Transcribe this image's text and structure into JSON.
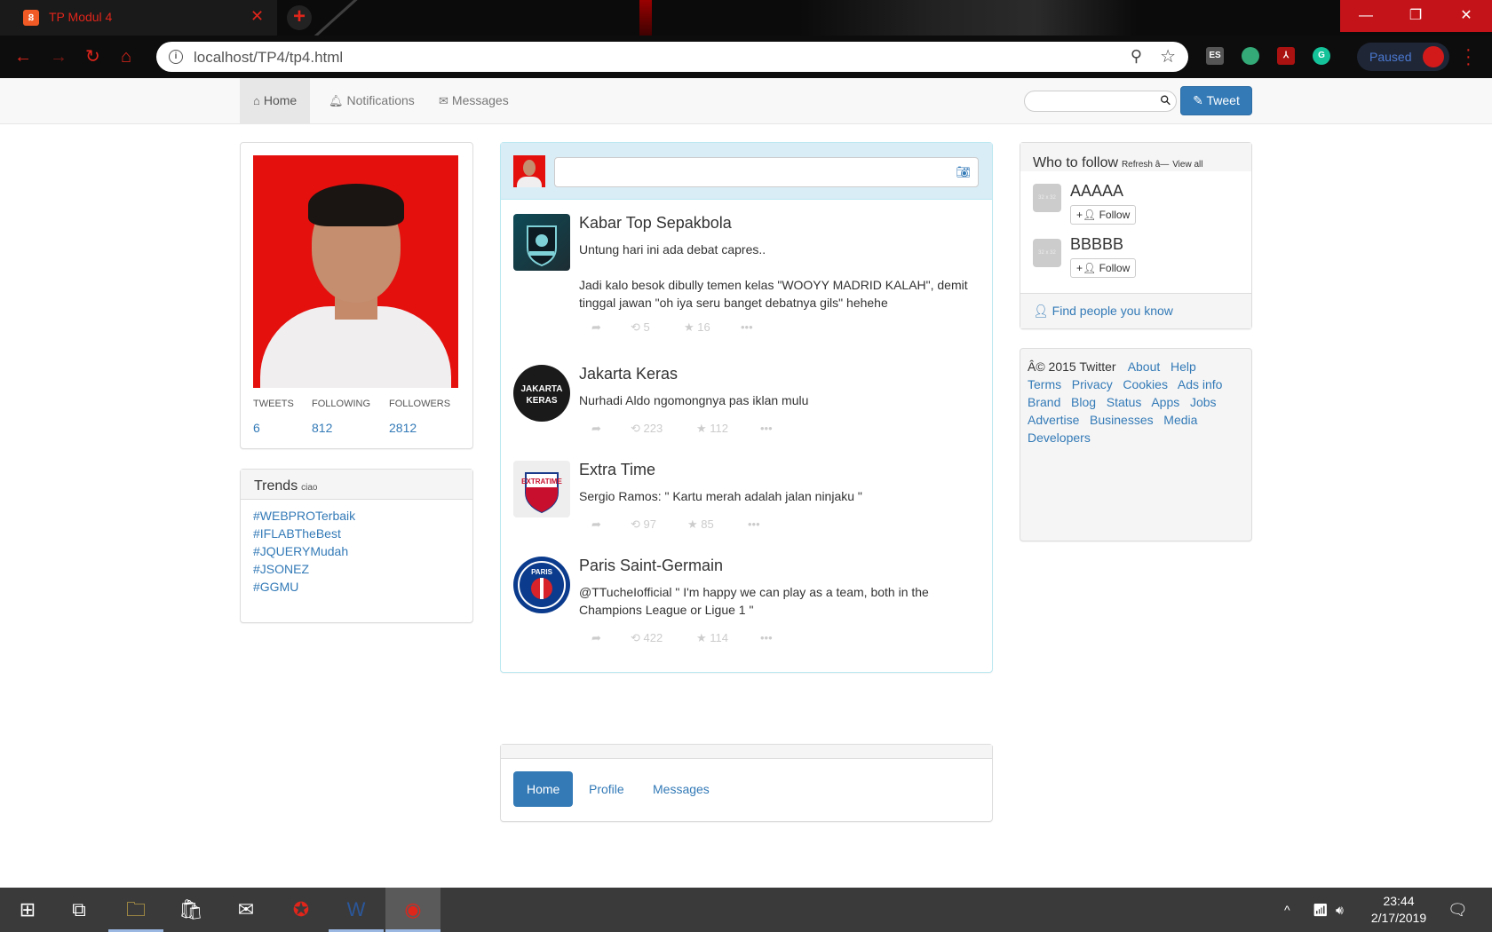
{
  "browser": {
    "tab_title": "TP Modul 4",
    "tab_close": "✕",
    "new_tab": "+",
    "url_host": "localhost",
    "url_path": "/TP4/tp4.html",
    "profile_status": "Paused",
    "ext_es": "ES",
    "window_controls": {
      "minimize": "—",
      "restore": "❐",
      "close": "✕"
    },
    "accent_color": "#e0251b"
  },
  "navbar": {
    "home": "Home",
    "notifications": "Notifications",
    "messages": "Messages",
    "search_placeholder": "",
    "tweet_button": "Tweet"
  },
  "profile": {
    "stats": [
      {
        "label": "TWEETS",
        "value": "6"
      },
      {
        "label": "FOLLOWING",
        "value": "812"
      },
      {
        "label": "FOLLOWERS",
        "value": "2812"
      }
    ]
  },
  "trends": {
    "title": "Trends",
    "subtitle": "ciao",
    "items": [
      "#WEBPROTerbaik",
      "#IFLABTheBest",
      "#JQUERYMudah",
      "#JSONEZ",
      "#GGMU"
    ]
  },
  "compose": {
    "placeholder": ""
  },
  "tweets": [
    {
      "name": "Kabar Top Sepakbola",
      "text": "Untung hari ini ada debat capres..\n\nJadi kalo besok dibully temen kelas \"WOOYY MADRID KALAH\", demit tinggal jawan \"oh iya seru banget debatnya gils\" hehehe",
      "retweets": "5",
      "likes": "16"
    },
    {
      "name": "Jakarta Keras",
      "text": "Nurhadi Aldo ngomongnya pas iklan mulu",
      "retweets": "223",
      "likes": "112",
      "avatar_text": "JAKARTA KERAS"
    },
    {
      "name": "Extra Time",
      "text": "Sergio Ramos: \" Kartu merah adalah jalan ninjaku \"",
      "retweets": "97",
      "likes": "85",
      "avatar_text": "EXTRATIME"
    },
    {
      "name": "Paris Saint-Germain",
      "text": "@TTucheIofficial \" I'm happy we can play as a team, both in the Champions League or Ligue 1 \"",
      "retweets": "422",
      "likes": "114",
      "avatar_text": "PARIS"
    }
  ],
  "who_to_follow": {
    "title": "Who to follow",
    "refresh": "Refresh â—",
    "view_all": "View all",
    "suggestions": [
      {
        "name": "AAAAA",
        "button": "Follow",
        "avatar_text": "32 x 32"
      },
      {
        "name": "BBBBB",
        "button": "Follow",
        "avatar_text": "32 x 32"
      }
    ],
    "find_people": "Find people you know"
  },
  "footer": {
    "copyright": "Â© 2015 Twitter",
    "links": [
      "About",
      "Help",
      "Terms",
      "Privacy",
      "Cookies",
      "Ads info",
      "Brand",
      "Blog",
      "Status",
      "Apps",
      "Jobs",
      "Advertise",
      "Businesses",
      "Media",
      "Developers"
    ]
  },
  "bottom_nav": {
    "home": "Home",
    "profile": "Profile",
    "messages": "Messages"
  },
  "taskbar": {
    "time": "23:44",
    "date": "2/17/2019"
  }
}
